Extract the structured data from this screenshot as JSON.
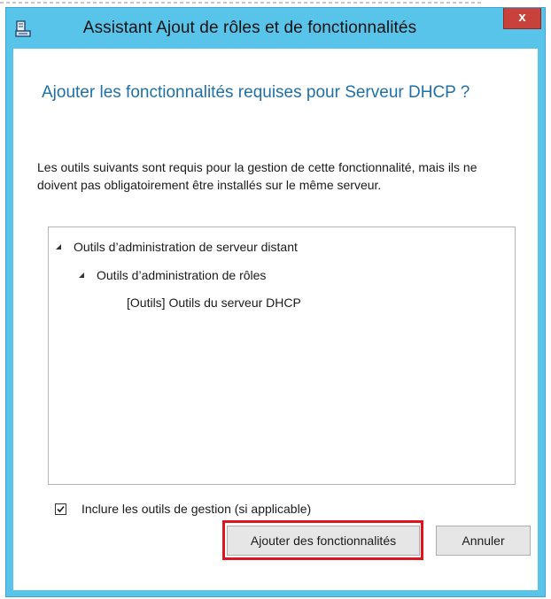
{
  "window": {
    "title": "Assistant Ajout de rôles et de fonctionnalités",
    "close_label": "x",
    "title_icon": "wizard-server-icon"
  },
  "dialog": {
    "heading": "Ajouter les fonctionnalités requises pour Serveur DHCP ?",
    "description": "Les outils suivants sont requis pour la gestion de cette fonctionnalité, mais ils ne doivent pas obligatoirement être installés sur le même serveur.",
    "tree": [
      {
        "label": "Outils d’administration de serveur distant",
        "expanded": true
      },
      {
        "label": "Outils d’administration de rôles",
        "expanded": true
      },
      {
        "label": "[Outils] Outils du serveur DHCP"
      }
    ],
    "include_tools_label": "Inclure les outils de gestion (si applicable)",
    "include_tools_checked": true
  },
  "buttons": {
    "add_label": "Ajouter des fonctionnalités",
    "cancel_label": "Annuler"
  },
  "colors": {
    "titlebar": "#58c4ea",
    "heading": "#1f6fa8",
    "close": "#c8413a",
    "highlight": "#e0141e"
  }
}
